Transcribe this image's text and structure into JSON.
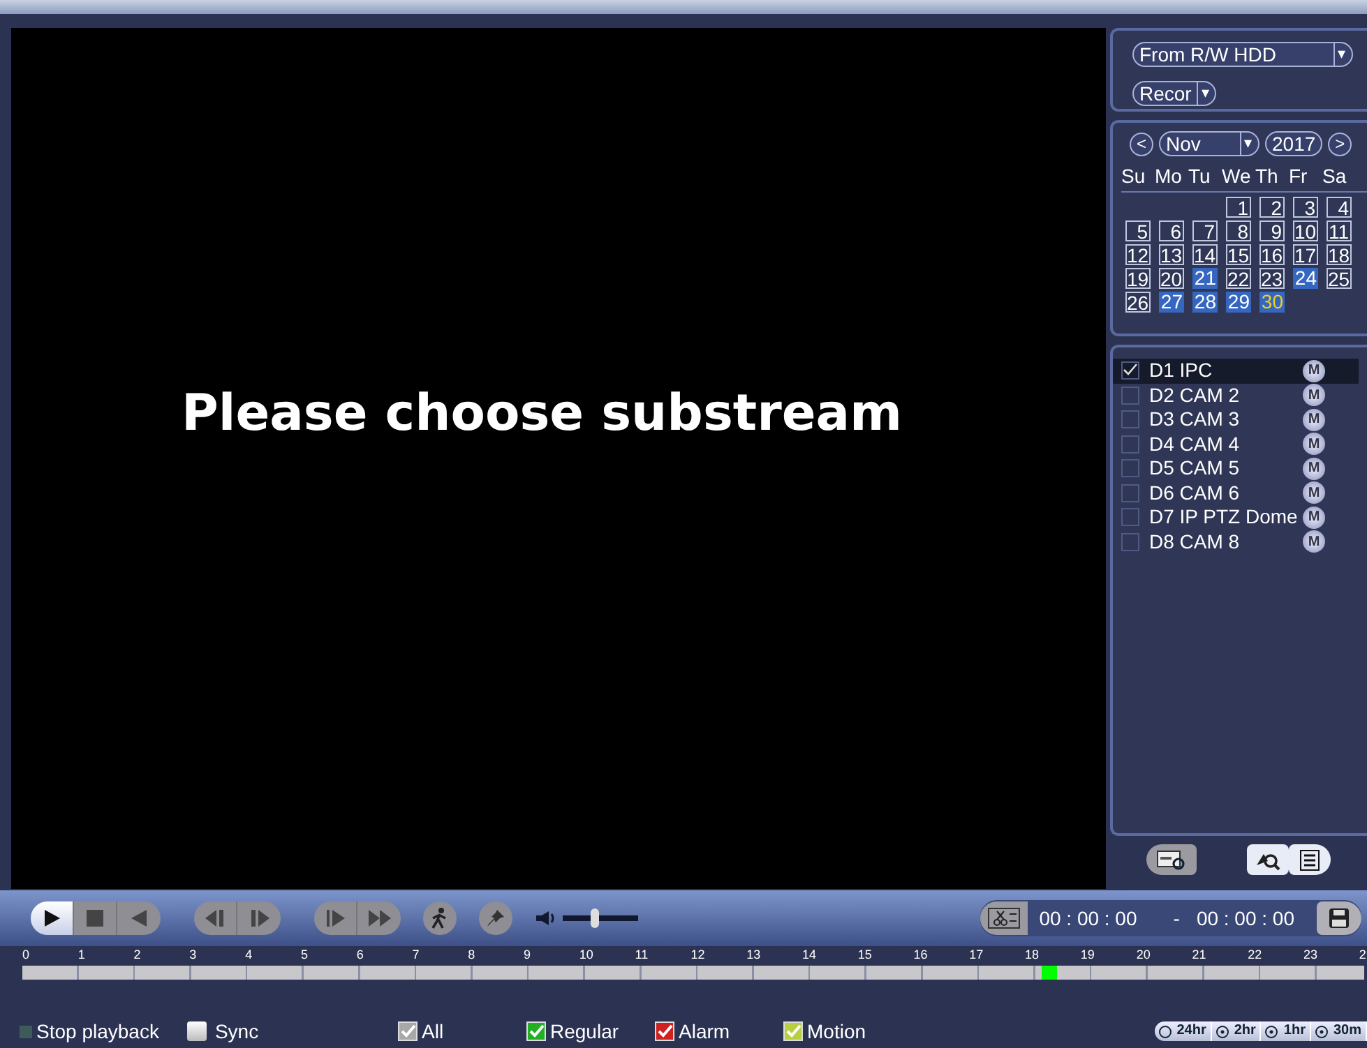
{
  "video": {
    "message": "Please choose substream"
  },
  "source": {
    "value": "From R/W HDD",
    "arrow": "▾"
  },
  "record_type": {
    "value": "Recor",
    "arrow": "▾"
  },
  "calendar": {
    "prev": "<",
    "month": "Nov",
    "month_arrow": "▾",
    "year": "2017",
    "next": ">",
    "weekdays": [
      "Su",
      "Mo",
      "Tu",
      "We",
      "Th",
      "Fr",
      "Sa"
    ],
    "days": [
      {
        "day": "1",
        "kind": "plain"
      },
      {
        "day": "2",
        "kind": "plain"
      },
      {
        "day": "3",
        "kind": "plain"
      },
      {
        "day": "4",
        "kind": "plain"
      },
      {
        "day": "5",
        "kind": "plain"
      },
      {
        "day": "6",
        "kind": "plain"
      },
      {
        "day": "7",
        "kind": "plain"
      },
      {
        "day": "8",
        "kind": "plain"
      },
      {
        "day": "9",
        "kind": "plain"
      },
      {
        "day": "10",
        "kind": "plain"
      },
      {
        "day": "11",
        "kind": "plain"
      },
      {
        "day": "12",
        "kind": "plain"
      },
      {
        "day": "13",
        "kind": "plain"
      },
      {
        "day": "14",
        "kind": "plain"
      },
      {
        "day": "15",
        "kind": "plain"
      },
      {
        "day": "16",
        "kind": "plain"
      },
      {
        "day": "17",
        "kind": "plain"
      },
      {
        "day": "18",
        "kind": "plain"
      },
      {
        "day": "19",
        "kind": "plain"
      },
      {
        "day": "20",
        "kind": "plain"
      },
      {
        "day": "21",
        "kind": "recorded"
      },
      {
        "day": "22",
        "kind": "plain"
      },
      {
        "day": "23",
        "kind": "plain"
      },
      {
        "day": "24",
        "kind": "recorded"
      },
      {
        "day": "25",
        "kind": "plain"
      },
      {
        "day": "26",
        "kind": "plain"
      },
      {
        "day": "27",
        "kind": "recorded"
      },
      {
        "day": "28",
        "kind": "recorded"
      },
      {
        "day": "29",
        "kind": "recorded"
      },
      {
        "day": "30",
        "kind": "current"
      }
    ]
  },
  "channels": [
    {
      "label": "D1 IPC",
      "checked": true,
      "selected": true,
      "badge": "M"
    },
    {
      "label": "D2 CAM 2",
      "checked": false,
      "selected": false,
      "badge": "M"
    },
    {
      "label": "D3 CAM 3",
      "checked": false,
      "selected": false,
      "badge": "M"
    },
    {
      "label": "D4 CAM 4",
      "checked": false,
      "selected": false,
      "badge": "M"
    },
    {
      "label": "D5 CAM 5",
      "checked": false,
      "selected": false,
      "badge": "M"
    },
    {
      "label": "D6 CAM 6",
      "checked": false,
      "selected": false,
      "badge": "M"
    },
    {
      "label": "D7 IP PTZ Dome",
      "checked": false,
      "selected": false,
      "badge": "M"
    },
    {
      "label": "D8 CAM 8",
      "checked": false,
      "selected": false,
      "badge": "M"
    }
  ],
  "volume": {
    "level": 0.42
  },
  "clip": {
    "start": "00 : 00 : 00",
    "separator": "-",
    "end": "00 : 00 : 00"
  },
  "timeline": {
    "hours": [
      "0",
      "1",
      "2",
      "3",
      "4",
      "5",
      "6",
      "7",
      "8",
      "9",
      "10",
      "11",
      "12",
      "13",
      "14",
      "15",
      "16",
      "17",
      "18",
      "19",
      "20",
      "21",
      "22",
      "23",
      "2"
    ]
  },
  "options": [
    {
      "label": "Stop playback",
      "kind": "indicator",
      "checked": false
    },
    {
      "label": "Sync",
      "kind": "checkbox",
      "checked": false
    }
  ],
  "filters": [
    {
      "label": "All",
      "checked": true,
      "color": "#a8a8a8"
    },
    {
      "label": "Regular",
      "checked": true,
      "color": "#22b022"
    },
    {
      "label": "Alarm",
      "checked": true,
      "color": "#d02020"
    },
    {
      "label": "Motion",
      "checked": true,
      "color": "#b8d040"
    }
  ],
  "zoom_buttons": [
    {
      "label": "24hr",
      "kind": "plain"
    },
    {
      "label": "2hr",
      "kind": "plus"
    },
    {
      "label": "1hr",
      "kind": "plus"
    },
    {
      "label": "30m",
      "kind": "plus"
    }
  ]
}
